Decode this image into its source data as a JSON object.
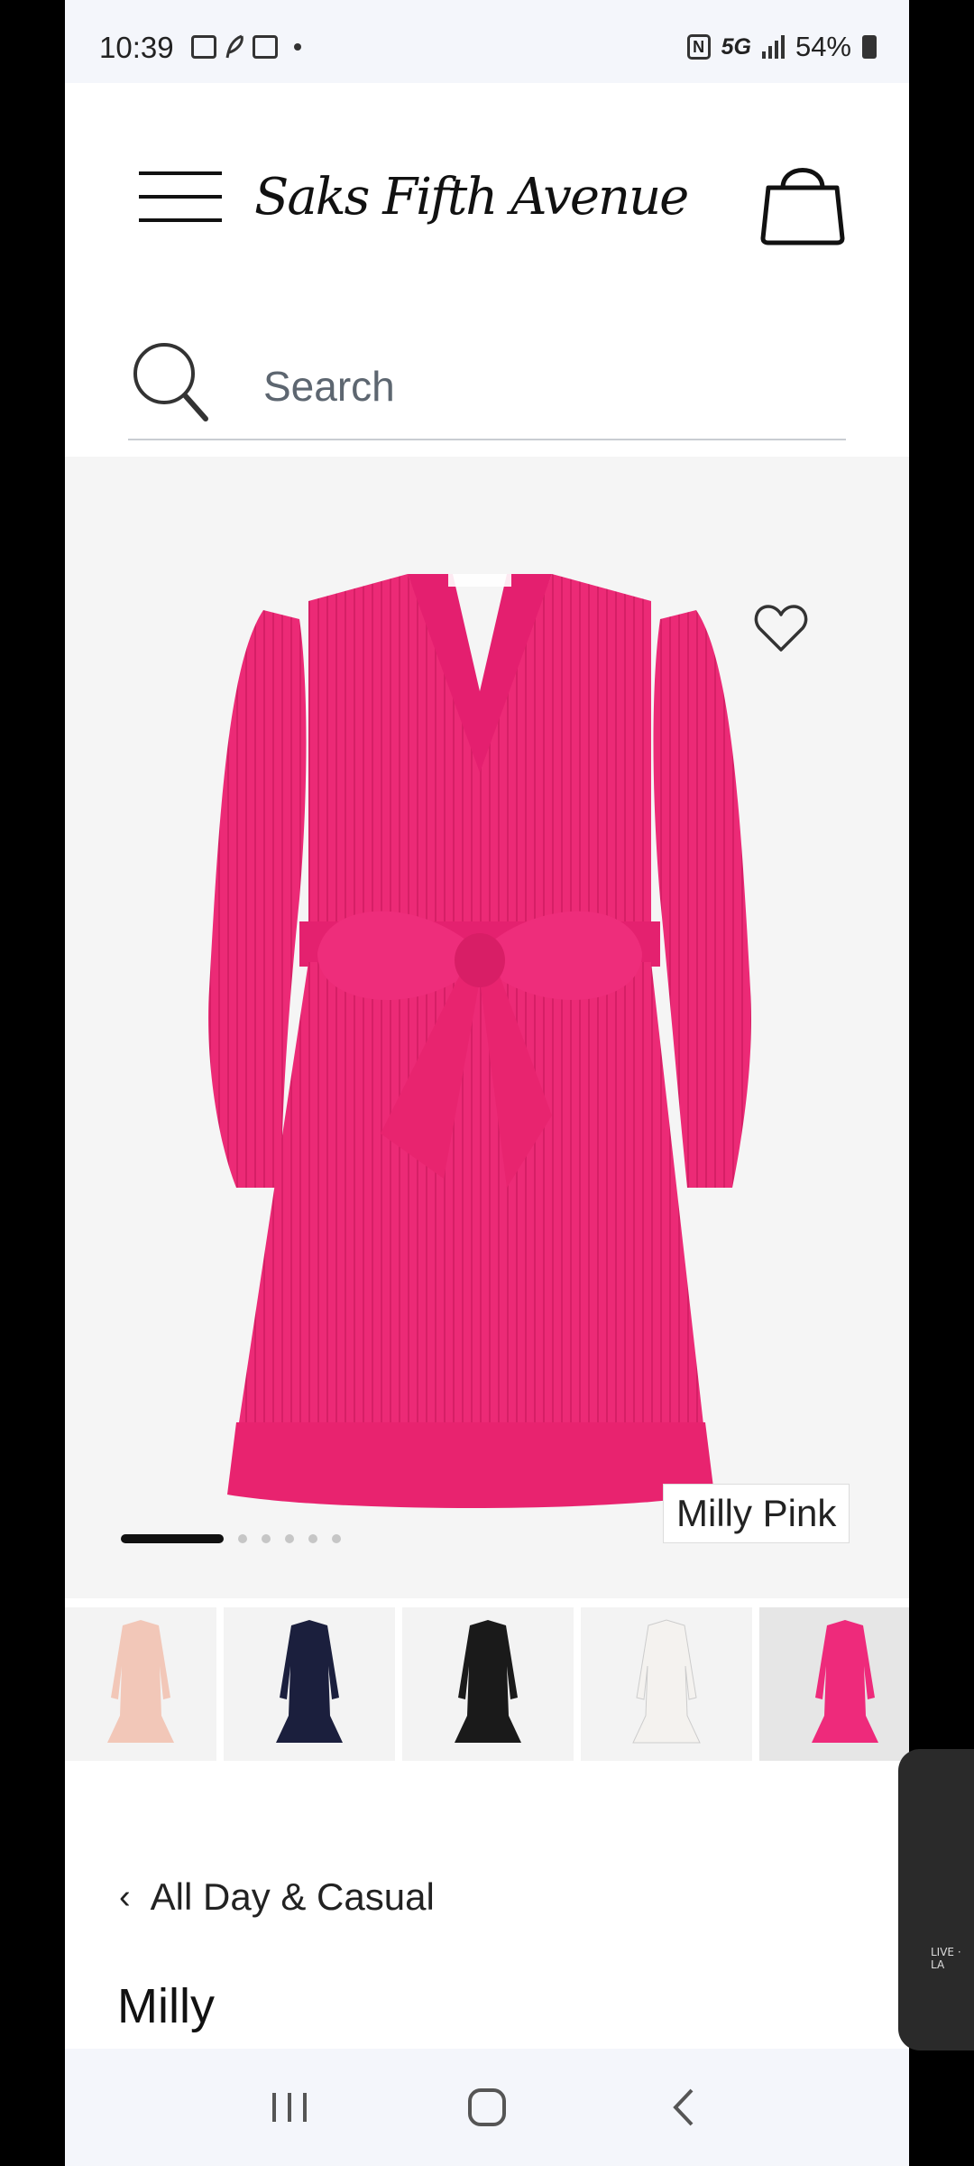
{
  "status_bar": {
    "time": "10:39",
    "network": "5G",
    "battery": "54%"
  },
  "header": {
    "logo": "Saks Fifth Avenue"
  },
  "search": {
    "placeholder": "Search"
  },
  "product": {
    "color_label": "Milly Pink",
    "image_count": 6,
    "active_image": 1,
    "colors": [
      {
        "hex": "#f2c7b8"
      },
      {
        "hex": "#1b1f3d"
      },
      {
        "hex": "#1a1a1a"
      },
      {
        "hex": "#f4f2ef"
      },
      {
        "hex": "#ee2a7b"
      }
    ],
    "selected_color_index": 4
  },
  "details": {
    "breadcrumb": "All Day & Casual",
    "brand": "Milly"
  },
  "pip": {
    "label": "LIVE · LA"
  }
}
